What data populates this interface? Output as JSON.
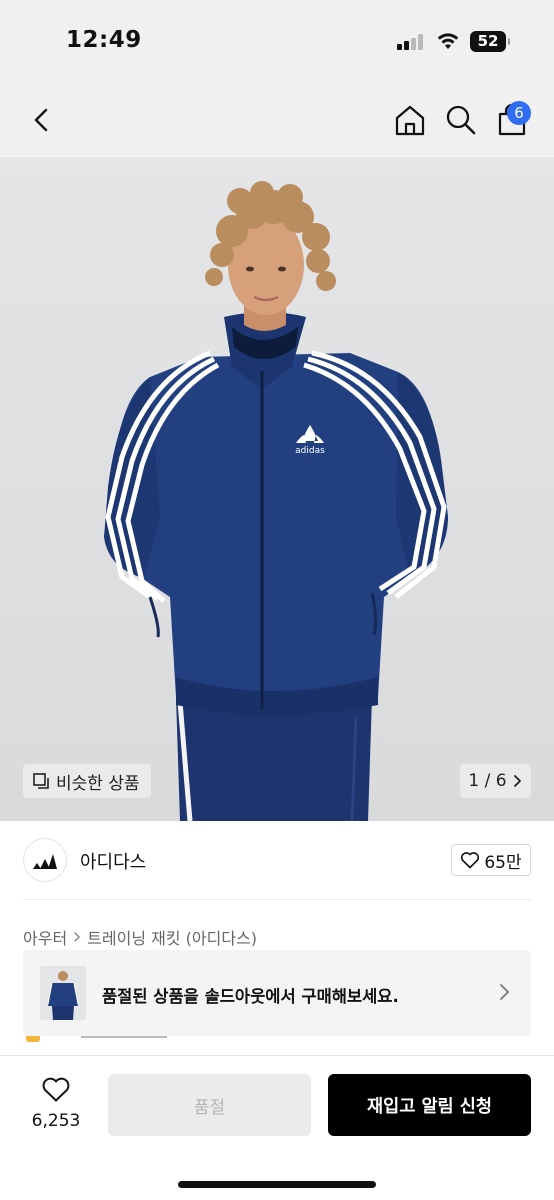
{
  "status_bar": {
    "time": "12:49",
    "battery": "52"
  },
  "nav": {
    "cart_count": "6"
  },
  "hero": {
    "similar_label": "비슷한 상품",
    "page_counter": "1 / 6"
  },
  "brand": {
    "name": "아디다스",
    "likes": "65만"
  },
  "breadcrumb": {
    "category": "아우터",
    "subcategory": "트레이닝 재킷 (아디다스)"
  },
  "banner": {
    "text": "품절된 상품을 솔드아웃에서 구매해보세요."
  },
  "bottom": {
    "wish_count": "6,253",
    "soldout_label": "품절",
    "restock_label": "재입고 알림 신청"
  },
  "colors": {
    "accent_badge": "#2f6ef3",
    "jacket_navy": "#1f3a78",
    "cta_black": "#000000"
  },
  "icons": [
    "back-icon",
    "home-icon",
    "search-icon",
    "bag-icon",
    "similar-icon",
    "chevron-right-icon",
    "adidas-logo",
    "heart-icon"
  ]
}
